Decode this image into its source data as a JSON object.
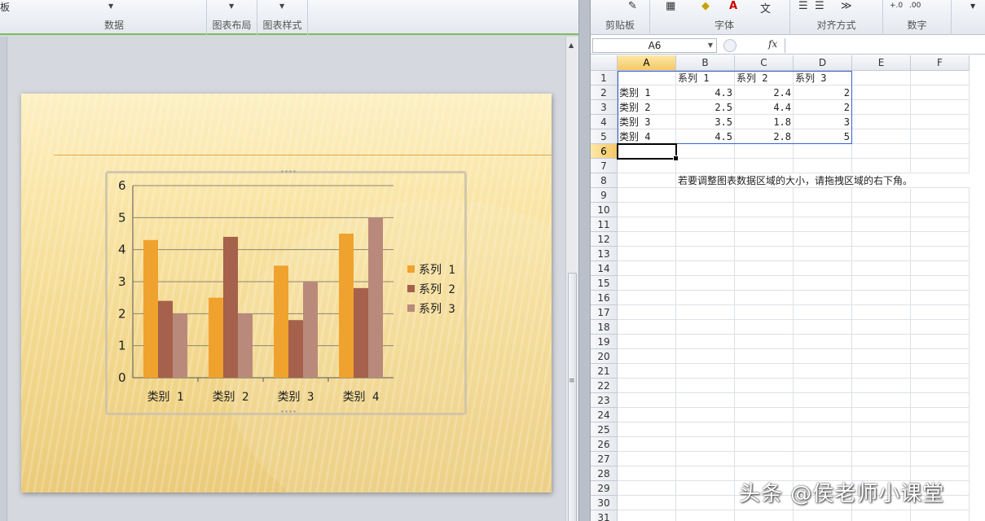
{
  "ppt": {
    "ribbon": {
      "clip_text": "板",
      "groups": [
        {
          "label": "数据"
        },
        {
          "label": "图表布局"
        },
        {
          "label": "图表样式"
        }
      ]
    }
  },
  "excel": {
    "ribbon": {
      "groups": [
        {
          "label": "剪贴板"
        },
        {
          "label": "字体"
        },
        {
          "label": "对齐方式"
        },
        {
          "label": "数字"
        }
      ]
    },
    "namebox": "A6",
    "fx_label": "fx",
    "columns": [
      "A",
      "B",
      "C",
      "D",
      "E",
      "F"
    ],
    "rows": [
      "1",
      "2",
      "3",
      "4",
      "5",
      "6",
      "7",
      "8",
      "9",
      "10",
      "11",
      "12",
      "13",
      "14",
      "15",
      "16",
      "17",
      "18",
      "19",
      "20",
      "21",
      "22",
      "23",
      "24",
      "25",
      "26",
      "27",
      "28",
      "29",
      "30",
      "31"
    ],
    "cells": {
      "r1": [
        "",
        "系列 1",
        "系列 2",
        "系列 3"
      ],
      "r2": [
        "类别 1",
        "4.3",
        "2.4",
        "2"
      ],
      "r3": [
        "类别 2",
        "2.5",
        "4.4",
        "2"
      ],
      "r4": [
        "类别 3",
        "3.5",
        "1.8",
        "3"
      ],
      "r5": [
        "类别 4",
        "4.5",
        "2.8",
        "5"
      ]
    },
    "note": "若要调整图表数据区域的大小，请拖拽区域的右下角。"
  },
  "watermark": "头条 @侯老师小课堂",
  "chart_data": {
    "type": "bar",
    "categories": [
      "类别 1",
      "类别 2",
      "类别 3",
      "类别 4"
    ],
    "series": [
      {
        "name": "系列 1",
        "values": [
          4.3,
          2.5,
          3.5,
          4.5
        ],
        "color": "#f0a22e"
      },
      {
        "name": "系列 2",
        "values": [
          2.4,
          4.4,
          1.8,
          2.8
        ],
        "color": "#a5614b"
      },
      {
        "name": "系列 3",
        "values": [
          2,
          2,
          3,
          5
        ],
        "color": "#b98a7b"
      }
    ],
    "yticks": [
      "0",
      "1",
      "2",
      "3",
      "4",
      "5",
      "6"
    ],
    "ylim": [
      0,
      6
    ],
    "grid": true,
    "legend": "right"
  }
}
